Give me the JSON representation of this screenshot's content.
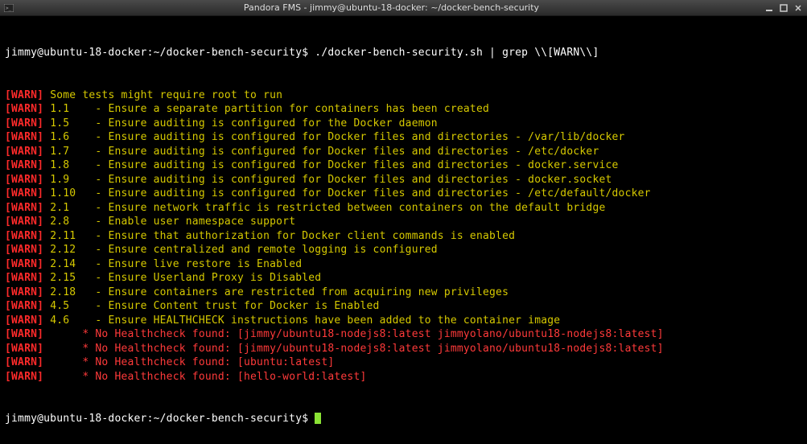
{
  "window": {
    "title": "Pandora FMS - jimmy@ubuntu-18-docker: ~/docker-bench-security"
  },
  "prompt": {
    "ps1": "jimmy@ubuntu-18-docker:~/docker-bench-security$",
    "command": "./docker-bench-security.sh | grep \\\\[WARN\\\\]"
  },
  "warn_label": "WARN",
  "lines": [
    {
      "num": "",
      "dash": "",
      "msg": "Some tests might require root to run",
      "color": "yellow"
    },
    {
      "num": "1.1",
      "dash": "  - ",
      "msg": "Ensure a separate partition for containers has been created",
      "color": "yellow"
    },
    {
      "num": "1.5",
      "dash": "  - ",
      "msg": "Ensure auditing is configured for the Docker daemon",
      "color": "yellow"
    },
    {
      "num": "1.6",
      "dash": "  - ",
      "msg": "Ensure auditing is configured for Docker files and directories - /var/lib/docker",
      "color": "yellow"
    },
    {
      "num": "1.7",
      "dash": "  - ",
      "msg": "Ensure auditing is configured for Docker files and directories - /etc/docker",
      "color": "yellow"
    },
    {
      "num": "1.8",
      "dash": "  - ",
      "msg": "Ensure auditing is configured for Docker files and directories - docker.service",
      "color": "yellow"
    },
    {
      "num": "1.9",
      "dash": "  - ",
      "msg": "Ensure auditing is configured for Docker files and directories - docker.socket",
      "color": "yellow"
    },
    {
      "num": "1.10",
      "dash": "  - ",
      "msg": "Ensure auditing is configured for Docker files and directories - /etc/default/docker",
      "color": "yellow"
    },
    {
      "num": "2.1",
      "dash": "  - ",
      "msg": "Ensure network traffic is restricted between containers on the default bridge",
      "color": "yellow"
    },
    {
      "num": "2.8",
      "dash": "  - ",
      "msg": "Enable user namespace support",
      "color": "yellow"
    },
    {
      "num": "2.11",
      "dash": "  - ",
      "msg": "Ensure that authorization for Docker client commands is enabled",
      "color": "yellow"
    },
    {
      "num": "2.12",
      "dash": "  - ",
      "msg": "Ensure centralized and remote logging is configured",
      "color": "yellow"
    },
    {
      "num": "2.14",
      "dash": "  - ",
      "msg": "Ensure live restore is Enabled",
      "color": "yellow"
    },
    {
      "num": "2.15",
      "dash": "  - ",
      "msg": "Ensure Userland Proxy is Disabled",
      "color": "yellow"
    },
    {
      "num": "2.18",
      "dash": "  - ",
      "msg": "Ensure containers are restricted from acquiring new privileges",
      "color": "yellow"
    },
    {
      "num": "4.5",
      "dash": "  - ",
      "msg": "Ensure Content trust for Docker is Enabled",
      "color": "yellow"
    },
    {
      "num": "4.6",
      "dash": "  - ",
      "msg": "Ensure HEALTHCHECK instructions have been added to the container image",
      "color": "yellow"
    },
    {
      "num": "",
      "dash": "     ",
      "msg": "* No Healthcheck found: [jimmy/ubuntu18-nodejs8:latest jimmyolano/ubuntu18-nodejs8:latest]",
      "color": "red"
    },
    {
      "num": "",
      "dash": "     ",
      "msg": "* No Healthcheck found: [jimmy/ubuntu18-nodejs8:latest jimmyolano/ubuntu18-nodejs8:latest]",
      "color": "red"
    },
    {
      "num": "",
      "dash": "     ",
      "msg": "* No Healthcheck found: [ubuntu:latest]",
      "color": "red"
    },
    {
      "num": "",
      "dash": "     ",
      "msg": "* No Healthcheck found: [hello-world:latest]",
      "color": "red"
    }
  ]
}
